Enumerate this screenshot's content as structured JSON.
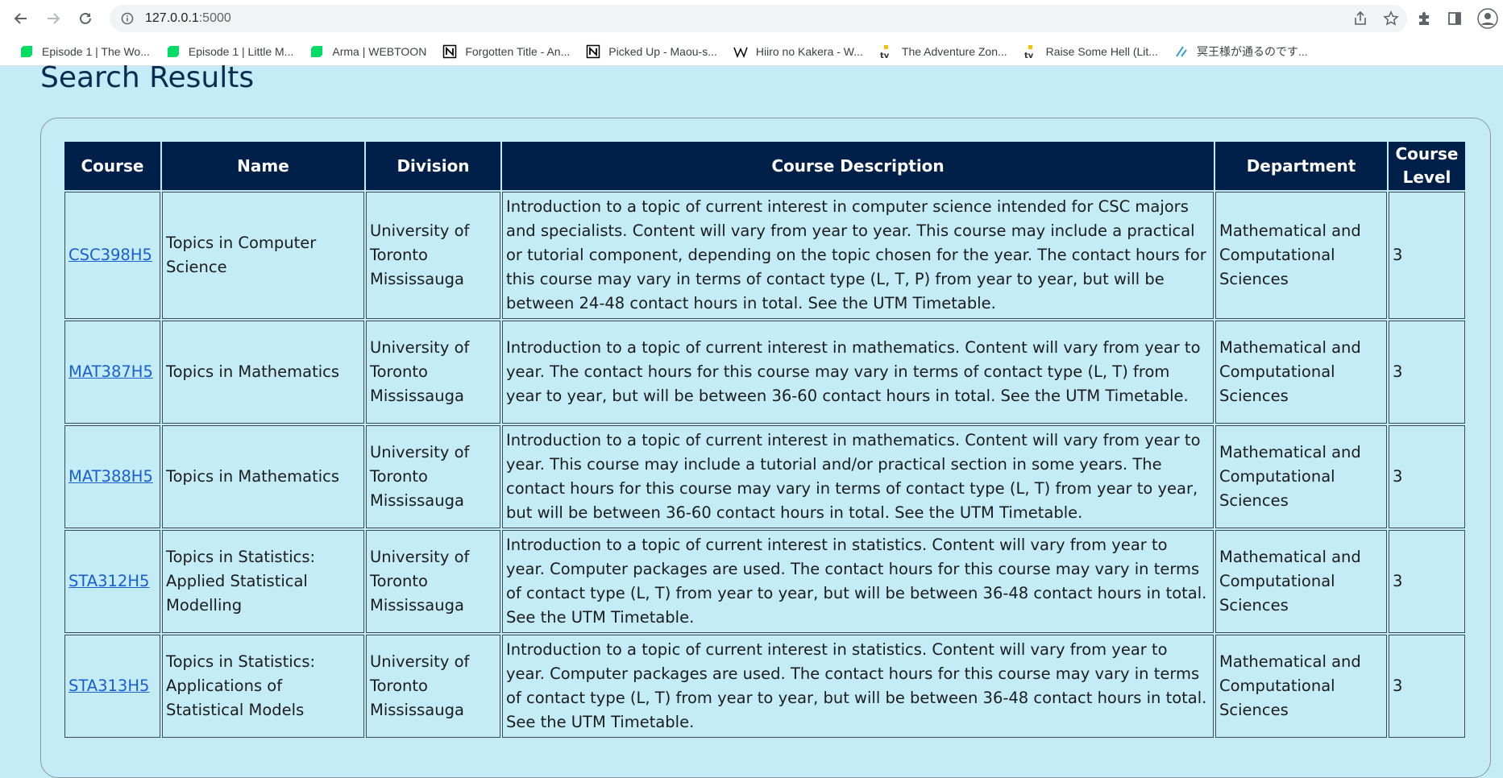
{
  "browser": {
    "url_host": "127.0.0.1",
    "url_port": ":5000",
    "bookmarks": [
      {
        "label": "Episode 1 | The Wo...",
        "icon": "webtoon-icon",
        "color": "#00dc64"
      },
      {
        "label": "Episode 1 | Little M...",
        "icon": "webtoon-icon",
        "color": "#00dc64"
      },
      {
        "label": "Arma | WEBTOON",
        "icon": "webtoon-icon",
        "color": "#00dc64"
      },
      {
        "label": "Forgotten Title - An...",
        "icon": "notion-icon",
        "color": "#000000"
      },
      {
        "label": "Picked Up - Maou-s...",
        "icon": "notion-icon",
        "color": "#000000"
      },
      {
        "label": "Hiiro no Kakera - W...",
        "icon": "wikipedia-icon",
        "color": "#000000"
      },
      {
        "label": "The Adventure Zon...",
        "icon": "tvtropes-icon",
        "color": "#f2c200"
      },
      {
        "label": "Raise Some Hell (Lit...",
        "icon": "tvtropes-icon",
        "color": "#f2c200"
      },
      {
        "label": "冥王様が通るのです...",
        "icon": "kakuyomu-icon",
        "color": "#2aa3c8"
      }
    ]
  },
  "page": {
    "title": "Search Results"
  },
  "table": {
    "headers": [
      "Course",
      "Name",
      "Division",
      "Course Description",
      "Department",
      "Course Level"
    ],
    "rows": [
      {
        "code": "CSC398H5",
        "name": "Topics in Computer Science",
        "division": "University of Toronto Mississauga",
        "description": "Introduction to a topic of current interest in computer science intended for CSC majors and specialists. Content will vary from year to year. This course may include a practical or tutorial component, depending on the topic chosen for the year. The contact hours for this course may vary in terms of contact type (L, T, P) from year to year, but will be between 24-48 contact hours in total. See the UTM Timetable.",
        "department": "Mathematical and Computational Sciences",
        "level": "3"
      },
      {
        "code": "MAT387H5",
        "name": "Topics in Mathematics",
        "division": "University of Toronto Mississauga",
        "description": "Introduction to a topic of current interest in mathematics. Content will vary from year to year. The contact hours for this course may vary in terms of contact type (L, T) from year to year, but will be between 36-60 contact hours in total. See the UTM Timetable.",
        "department": "Mathematical and Computational Sciences",
        "level": "3"
      },
      {
        "code": "MAT388H5",
        "name": "Topics in Mathematics",
        "division": "University of Toronto Mississauga",
        "description": "Introduction to a topic of current interest in mathematics. Content will vary from year to year. This course may include a tutorial and/or practical section in some years. The contact hours for this course may vary in terms of contact type (L, T) from year to year, but will be between 36-60 contact hours in total. See the UTM Timetable.",
        "department": "Mathematical and Computational Sciences",
        "level": "3"
      },
      {
        "code": "STA312H5",
        "name": "Topics in Statistics: Applied Statistical Modelling",
        "division": "University of Toronto Mississauga",
        "description": "Introduction to a topic of current interest in statistics. Content will vary from year to year. Computer packages are used. The contact hours for this course may vary in terms of contact type (L, T) from year to year, but will be between 36-48 contact hours in total. See the UTM Timetable.",
        "department": "Mathematical and Computational Sciences",
        "level": "3"
      },
      {
        "code": "STA313H5",
        "name": "Topics in Statistics: Applications of Statistical Models",
        "division": "University of Toronto Mississauga",
        "description": "Introduction to a topic of current interest in statistics. Content will vary from year to year. Computer packages are used. The contact hours for this course may vary in terms of contact type (L, T) from year to year, but will be between 36-48 contact hours in total. See the UTM Timetable.",
        "department": "Mathematical and Computational Sciences",
        "level": "3"
      }
    ]
  }
}
